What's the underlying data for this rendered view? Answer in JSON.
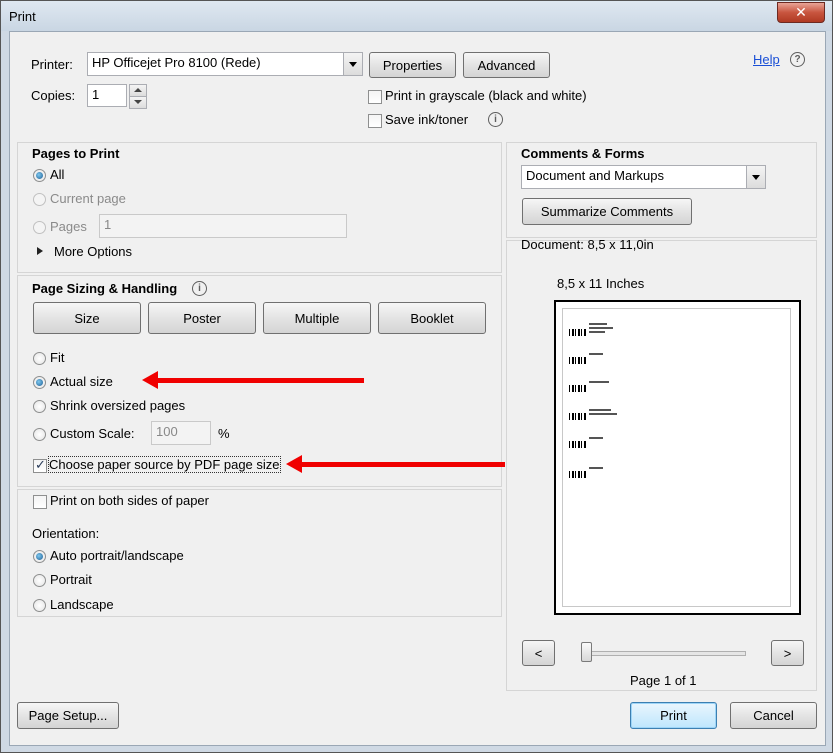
{
  "window": {
    "title": "Print",
    "close_glyph": "✕"
  },
  "printer": {
    "label": "Printer:",
    "value": "HP Officejet Pro 8100 (Rede)",
    "properties_label": "Properties",
    "advanced_label": "Advanced",
    "help_label": "Help",
    "copies_label": "Copies:",
    "copies_value": "1",
    "grayscale_label": "Print in grayscale (black and white)",
    "grayscale_checked": false,
    "save_ink_label": "Save ink/toner",
    "save_ink_checked": false
  },
  "pages_to_print": {
    "title": "Pages to Print",
    "all_label": "All",
    "current_label": "Current page",
    "pages_label": "Pages",
    "pages_value": "1",
    "more_options_label": "More Options",
    "selected": "All"
  },
  "page_sizing": {
    "title": "Page Sizing & Handling",
    "buttons": [
      "Size",
      "Poster",
      "Multiple",
      "Booklet"
    ],
    "fit_label": "Fit",
    "actual_label": "Actual size",
    "shrink_label": "Shrink oversized pages",
    "custom_label": "Custom Scale:",
    "custom_value": "100",
    "percent_label": "%",
    "choose_source_label": "Choose paper source by PDF page size",
    "choose_source_checked": true,
    "selected": "Actual size"
  },
  "duplex": {
    "both_sides_label": "Print on both sides of paper",
    "both_sides_checked": false,
    "orientation_label": "Orientation:",
    "auto_label": "Auto portrait/landscape",
    "portrait_label": "Portrait",
    "landscape_label": "Landscape",
    "selected": "Auto portrait/landscape"
  },
  "comments_forms": {
    "title": "Comments & Forms",
    "value": "Document and Markups",
    "summarize_label": "Summarize Comments"
  },
  "preview": {
    "document_size": "Document: 8,5 x 11,0in",
    "paper_label": "8,5 x 11 Inches",
    "prev_glyph": "<",
    "next_glyph": ">",
    "page_indicator": "Page 1 of 1",
    "annotation_color": "#f00000"
  },
  "footer": {
    "page_setup_label": "Page Setup...",
    "print_label": "Print",
    "cancel_label": "Cancel"
  }
}
